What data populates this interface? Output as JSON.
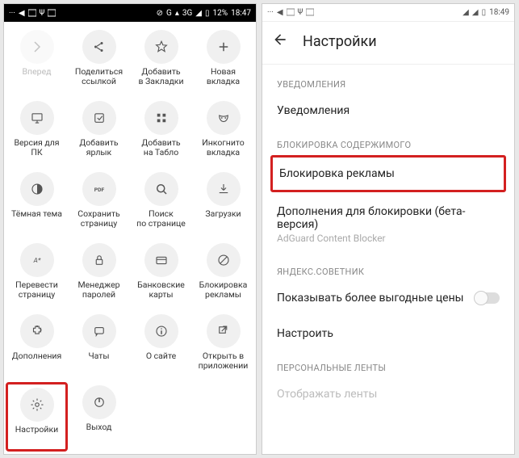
{
  "left": {
    "status": {
      "battery": "12%",
      "time": "18:47",
      "net1": "G",
      "net2": "3G"
    },
    "grid": [
      {
        "label": "Вперед",
        "icon": "forward",
        "disabled": true
      },
      {
        "label": "Поделиться\nссылкой",
        "icon": "share"
      },
      {
        "label": "Добавить\nв Закладки",
        "icon": "star"
      },
      {
        "label": "Новая\nвкладка",
        "icon": "plus"
      },
      {
        "label": "Версия для\nПК",
        "icon": "desktop"
      },
      {
        "label": "Добавить\nярлык",
        "icon": "shortcut"
      },
      {
        "label": "Добавить\nна Табло",
        "icon": "grid"
      },
      {
        "label": "Инкогнито\nвкладка",
        "icon": "mask"
      },
      {
        "label": "Тёмная тема",
        "icon": "half"
      },
      {
        "label": "Сохранить\nстраницу",
        "icon": "pdf"
      },
      {
        "label": "Поиск\nпо странице",
        "icon": "search"
      },
      {
        "label": "Загрузки",
        "icon": "download"
      },
      {
        "label": "Перевести\nстраницу",
        "icon": "translate"
      },
      {
        "label": "Менеджер\nпаролей",
        "icon": "lock"
      },
      {
        "label": "Банковские\nкарты",
        "icon": "card"
      },
      {
        "label": "Блокировка\nрекламы",
        "icon": "block"
      },
      {
        "label": "Дополнения",
        "icon": "extension"
      },
      {
        "label": "Чаты",
        "icon": "chat"
      },
      {
        "label": "О сайте",
        "icon": "info"
      },
      {
        "label": "Открыть в\nприложении",
        "icon": "open"
      },
      {
        "label": "Настройки",
        "icon": "gear",
        "highlight": true
      },
      {
        "label": "Выход",
        "icon": "power"
      }
    ]
  },
  "right": {
    "status": {
      "time": "18:49"
    },
    "title": "Настройки",
    "sections": {
      "notif_header": "УВЕДОМЛЕНИЯ",
      "notif": "Уведомления",
      "block_header": "БЛОКИРОВКА СОДЕРЖИМОГО",
      "block_ads": "Блокировка рекламы",
      "addons_label": "Дополнения для блокировки (бета-версия)",
      "addons_sub": "AdGuard Content Blocker",
      "advisor_header": "ЯНДЕКС.СОВЕТНИК",
      "advisor_toggle": "Показывать более выгодные цены",
      "configure": "Настроить",
      "feeds_header": "ПЕРСОНАЛЬНЫЕ ЛЕНТЫ",
      "feeds_cut": "Отображать ленты"
    }
  }
}
